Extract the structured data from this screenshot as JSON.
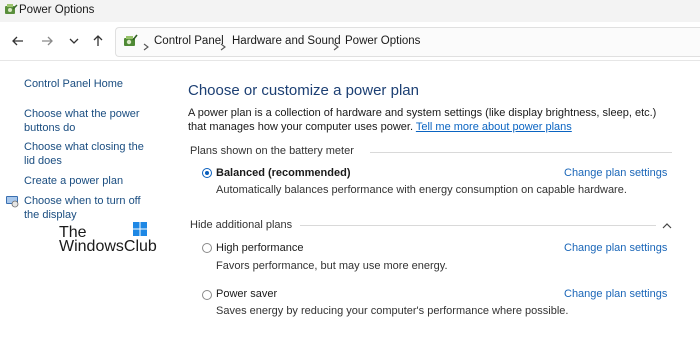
{
  "window": {
    "title": "Power Options"
  },
  "breadcrumb": [
    "Control Panel",
    "Hardware and Sound",
    "Power Options"
  ],
  "sidebar": {
    "items": [
      {
        "label": "Control Panel Home"
      },
      {
        "label": "Choose what the power buttons do"
      },
      {
        "label": "Choose what closing the lid does"
      },
      {
        "label": "Create a power plan"
      },
      {
        "label": "Choose when to turn off the display"
      }
    ]
  },
  "watermark": {
    "line1": "The",
    "line2": "WindowsClub"
  },
  "main": {
    "title": "Choose or customize a power plan",
    "description": "A power plan is a collection of hardware and system settings (like display brightness, sleep, etc.) that manages how your computer uses power.",
    "learn_more_link": "Tell me more about power plans",
    "battery_section_label": "Plans shown on the battery meter",
    "additional_section_label": "Hide additional plans",
    "plans": [
      {
        "name": "Balanced (recommended)",
        "description": "Automatically balances performance with energy consumption on capable hardware.",
        "selected": true,
        "change_link": "Change plan settings"
      },
      {
        "name": "High performance",
        "description": "Favors performance, but may use more energy.",
        "selected": false,
        "change_link": "Change plan settings"
      },
      {
        "name": "Power saver",
        "description": "Saves energy by reducing your computer's performance where possible.",
        "selected": false,
        "change_link": "Change plan settings"
      }
    ]
  },
  "colors": {
    "accent": "#0a5fbd",
    "link": "#1a66b8",
    "title": "#1c3f73"
  },
  "icons": {
    "app": "power-options-icon",
    "back": "arrow-left-icon",
    "forward": "arrow-right-icon",
    "recent": "chevron-down-icon",
    "up": "arrow-up-icon",
    "collapse": "chevron-up-icon"
  }
}
